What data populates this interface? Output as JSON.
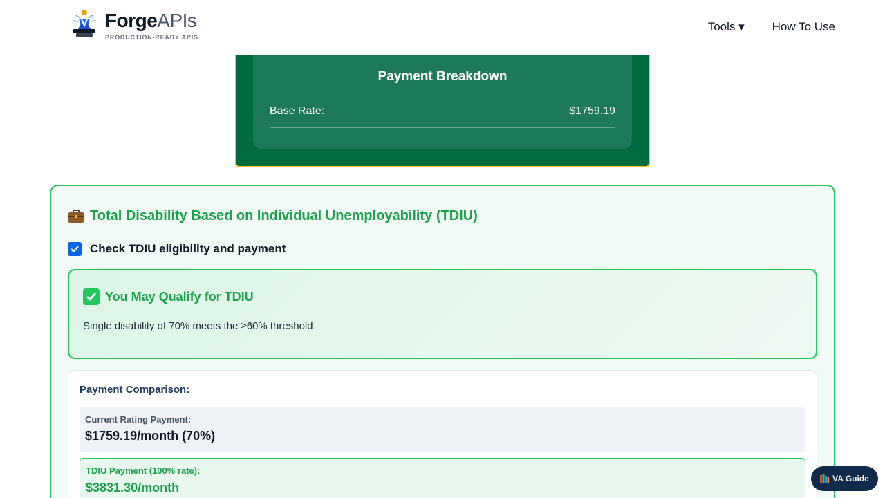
{
  "header": {
    "logo_name_bold": "Forge",
    "logo_name_light": "APIs",
    "logo_tagline": "PRODUCTION-READY APIS",
    "nav": [
      {
        "label": "Tools ▾"
      },
      {
        "label": "How To Use"
      }
    ]
  },
  "breakdown": {
    "title": "Payment Breakdown",
    "rows": [
      {
        "label": "Base Rate:",
        "value": "$1759.19"
      }
    ]
  },
  "tdiu": {
    "icon": "briefcase-icon",
    "title": "Total Disability Based on Individual Unemployability (TDIU)",
    "checkbox_label": "Check TDIU eligibility and payment",
    "checkbox_checked": true,
    "qualify": {
      "icon": "check-mark-icon",
      "title": "You May Qualify for TDIU",
      "text": "Single disability of 70% meets the ≥60% threshold"
    },
    "comparison": {
      "title": "Payment Comparison:",
      "current_label": "Current Rating Payment:",
      "current_value": "$1759.19/month (70%)",
      "tdiu_label": "TDIU Payment (100% rate):",
      "tdiu_value": "$3831.30/month"
    }
  },
  "floating": {
    "va_guide_label": "VA Guide",
    "icon": "books-icon"
  },
  "colors": {
    "card_green": "#006b3f",
    "card_border": "#fbbf24",
    "tdiu_green": "#16a34a",
    "checkbox_blue": "#0b63e5",
    "guide_navy": "#0f2a4a"
  }
}
